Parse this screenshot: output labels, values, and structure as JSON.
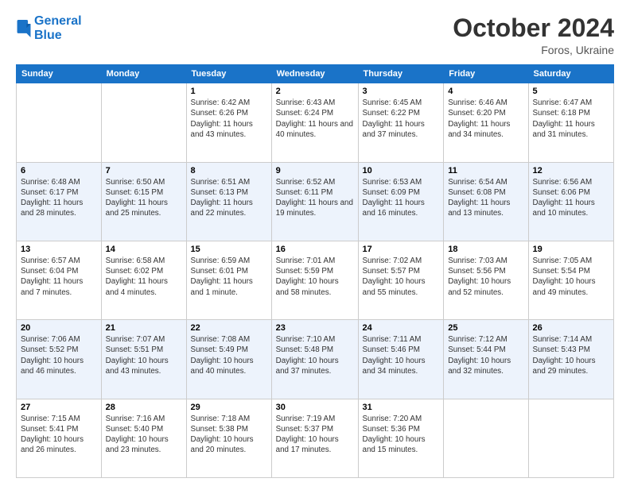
{
  "header": {
    "logo_line1": "General",
    "logo_line2": "Blue",
    "month": "October 2024",
    "location": "Foros, Ukraine"
  },
  "days_of_week": [
    "Sunday",
    "Monday",
    "Tuesday",
    "Wednesday",
    "Thursday",
    "Friday",
    "Saturday"
  ],
  "weeks": [
    [
      {
        "num": "",
        "info": ""
      },
      {
        "num": "",
        "info": ""
      },
      {
        "num": "1",
        "info": "Sunrise: 6:42 AM\nSunset: 6:26 PM\nDaylight: 11 hours and 43 minutes."
      },
      {
        "num": "2",
        "info": "Sunrise: 6:43 AM\nSunset: 6:24 PM\nDaylight: 11 hours and 40 minutes."
      },
      {
        "num": "3",
        "info": "Sunrise: 6:45 AM\nSunset: 6:22 PM\nDaylight: 11 hours and 37 minutes."
      },
      {
        "num": "4",
        "info": "Sunrise: 6:46 AM\nSunset: 6:20 PM\nDaylight: 11 hours and 34 minutes."
      },
      {
        "num": "5",
        "info": "Sunrise: 6:47 AM\nSunset: 6:18 PM\nDaylight: 11 hours and 31 minutes."
      }
    ],
    [
      {
        "num": "6",
        "info": "Sunrise: 6:48 AM\nSunset: 6:17 PM\nDaylight: 11 hours and 28 minutes."
      },
      {
        "num": "7",
        "info": "Sunrise: 6:50 AM\nSunset: 6:15 PM\nDaylight: 11 hours and 25 minutes."
      },
      {
        "num": "8",
        "info": "Sunrise: 6:51 AM\nSunset: 6:13 PM\nDaylight: 11 hours and 22 minutes."
      },
      {
        "num": "9",
        "info": "Sunrise: 6:52 AM\nSunset: 6:11 PM\nDaylight: 11 hours and 19 minutes."
      },
      {
        "num": "10",
        "info": "Sunrise: 6:53 AM\nSunset: 6:09 PM\nDaylight: 11 hours and 16 minutes."
      },
      {
        "num": "11",
        "info": "Sunrise: 6:54 AM\nSunset: 6:08 PM\nDaylight: 11 hours and 13 minutes."
      },
      {
        "num": "12",
        "info": "Sunrise: 6:56 AM\nSunset: 6:06 PM\nDaylight: 11 hours and 10 minutes."
      }
    ],
    [
      {
        "num": "13",
        "info": "Sunrise: 6:57 AM\nSunset: 6:04 PM\nDaylight: 11 hours and 7 minutes."
      },
      {
        "num": "14",
        "info": "Sunrise: 6:58 AM\nSunset: 6:02 PM\nDaylight: 11 hours and 4 minutes."
      },
      {
        "num": "15",
        "info": "Sunrise: 6:59 AM\nSunset: 6:01 PM\nDaylight: 11 hours and 1 minute."
      },
      {
        "num": "16",
        "info": "Sunrise: 7:01 AM\nSunset: 5:59 PM\nDaylight: 10 hours and 58 minutes."
      },
      {
        "num": "17",
        "info": "Sunrise: 7:02 AM\nSunset: 5:57 PM\nDaylight: 10 hours and 55 minutes."
      },
      {
        "num": "18",
        "info": "Sunrise: 7:03 AM\nSunset: 5:56 PM\nDaylight: 10 hours and 52 minutes."
      },
      {
        "num": "19",
        "info": "Sunrise: 7:05 AM\nSunset: 5:54 PM\nDaylight: 10 hours and 49 minutes."
      }
    ],
    [
      {
        "num": "20",
        "info": "Sunrise: 7:06 AM\nSunset: 5:52 PM\nDaylight: 10 hours and 46 minutes."
      },
      {
        "num": "21",
        "info": "Sunrise: 7:07 AM\nSunset: 5:51 PM\nDaylight: 10 hours and 43 minutes."
      },
      {
        "num": "22",
        "info": "Sunrise: 7:08 AM\nSunset: 5:49 PM\nDaylight: 10 hours and 40 minutes."
      },
      {
        "num": "23",
        "info": "Sunrise: 7:10 AM\nSunset: 5:48 PM\nDaylight: 10 hours and 37 minutes."
      },
      {
        "num": "24",
        "info": "Sunrise: 7:11 AM\nSunset: 5:46 PM\nDaylight: 10 hours and 34 minutes."
      },
      {
        "num": "25",
        "info": "Sunrise: 7:12 AM\nSunset: 5:44 PM\nDaylight: 10 hours and 32 minutes."
      },
      {
        "num": "26",
        "info": "Sunrise: 7:14 AM\nSunset: 5:43 PM\nDaylight: 10 hours and 29 minutes."
      }
    ],
    [
      {
        "num": "27",
        "info": "Sunrise: 7:15 AM\nSunset: 5:41 PM\nDaylight: 10 hours and 26 minutes."
      },
      {
        "num": "28",
        "info": "Sunrise: 7:16 AM\nSunset: 5:40 PM\nDaylight: 10 hours and 23 minutes."
      },
      {
        "num": "29",
        "info": "Sunrise: 7:18 AM\nSunset: 5:38 PM\nDaylight: 10 hours and 20 minutes."
      },
      {
        "num": "30",
        "info": "Sunrise: 7:19 AM\nSunset: 5:37 PM\nDaylight: 10 hours and 17 minutes."
      },
      {
        "num": "31",
        "info": "Sunrise: 7:20 AM\nSunset: 5:36 PM\nDaylight: 10 hours and 15 minutes."
      },
      {
        "num": "",
        "info": ""
      },
      {
        "num": "",
        "info": ""
      }
    ]
  ]
}
